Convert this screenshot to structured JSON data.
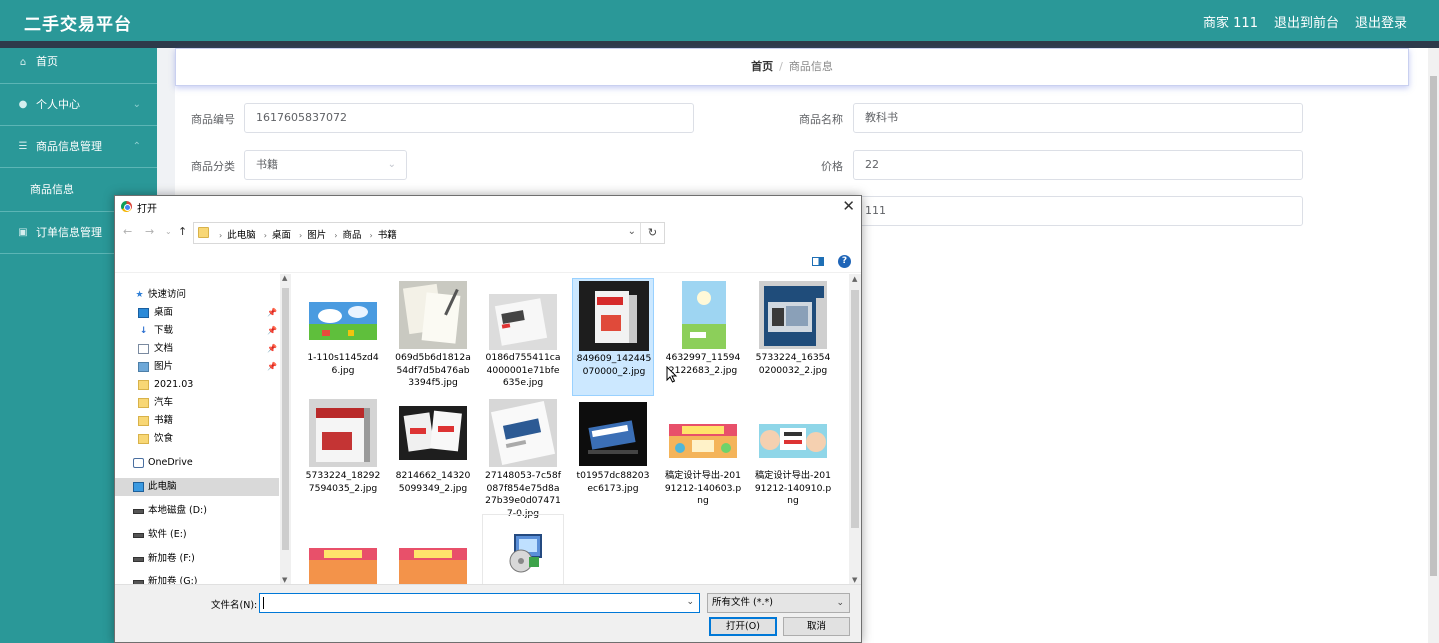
{
  "app": {
    "title": "二手交易平台",
    "user_label": "商家 111",
    "front_link": "退出到前台",
    "logout_link": "退出登录"
  },
  "sidebar": {
    "home": "首页",
    "personal": "个人中心",
    "goods_mgmt": "商品信息管理",
    "goods_info": "商品信息",
    "orders_mgmt": "订单信息管理"
  },
  "breadcrumb": {
    "home": "首页",
    "separator": "/",
    "current": "商品信息"
  },
  "form": {
    "code_label": "商品编号",
    "code_value": "1617605837072",
    "name_label": "商品名称",
    "name_value": "教科书",
    "category_label": "商品分类",
    "category_value": "书籍",
    "price_label": "价格",
    "price_value": "22",
    "third_value": "111"
  },
  "dialog": {
    "title": "打开",
    "path": [
      "此电脑",
      "桌面",
      "图片",
      "商品",
      "书籍"
    ],
    "nav": {
      "quick_access": "快速访问",
      "desktop": "桌面",
      "downloads": "下载",
      "documents": "文档",
      "pictures": "图片",
      "f2021": "2021.03",
      "cars": "汽车",
      "books": "书籍",
      "food": "饮食",
      "onedrive": "OneDrive",
      "this_pc": "此电脑",
      "drive_d": "本地磁盘 (D:)",
      "drive_e": "软件 (E:)",
      "drive_f": "新加卷 (F:)",
      "drive_g": "新加卷 (G:)"
    },
    "files": [
      "1-110s1145zd46.jpg",
      "069d5b6d1812a54df7d5b476ab3394f5.jpg",
      "0186d755411ca4000001e71bfe635e.jpg",
      "849609_142445070000_2.jpg",
      "4632997_115942122683_2.jpg",
      "5733224_163540200032_2.jpg",
      "5733224_182927594035_2.jpg",
      "8214662_143205099349_2.jpg",
      "27148053-7c58f087f854e75d8a27b39e0d074717-0.jpg",
      "t01957dc88203ec6173.jpg",
      "稿定设计导出-20191212-140603.png",
      "稿定设计导出-20191212-140910.png"
    ],
    "filename_label": "文件名(N):",
    "filename_value": "",
    "filetype_value": "所有文件 (*.*)",
    "open_button": "打开(O)",
    "cancel_button": "取消"
  }
}
